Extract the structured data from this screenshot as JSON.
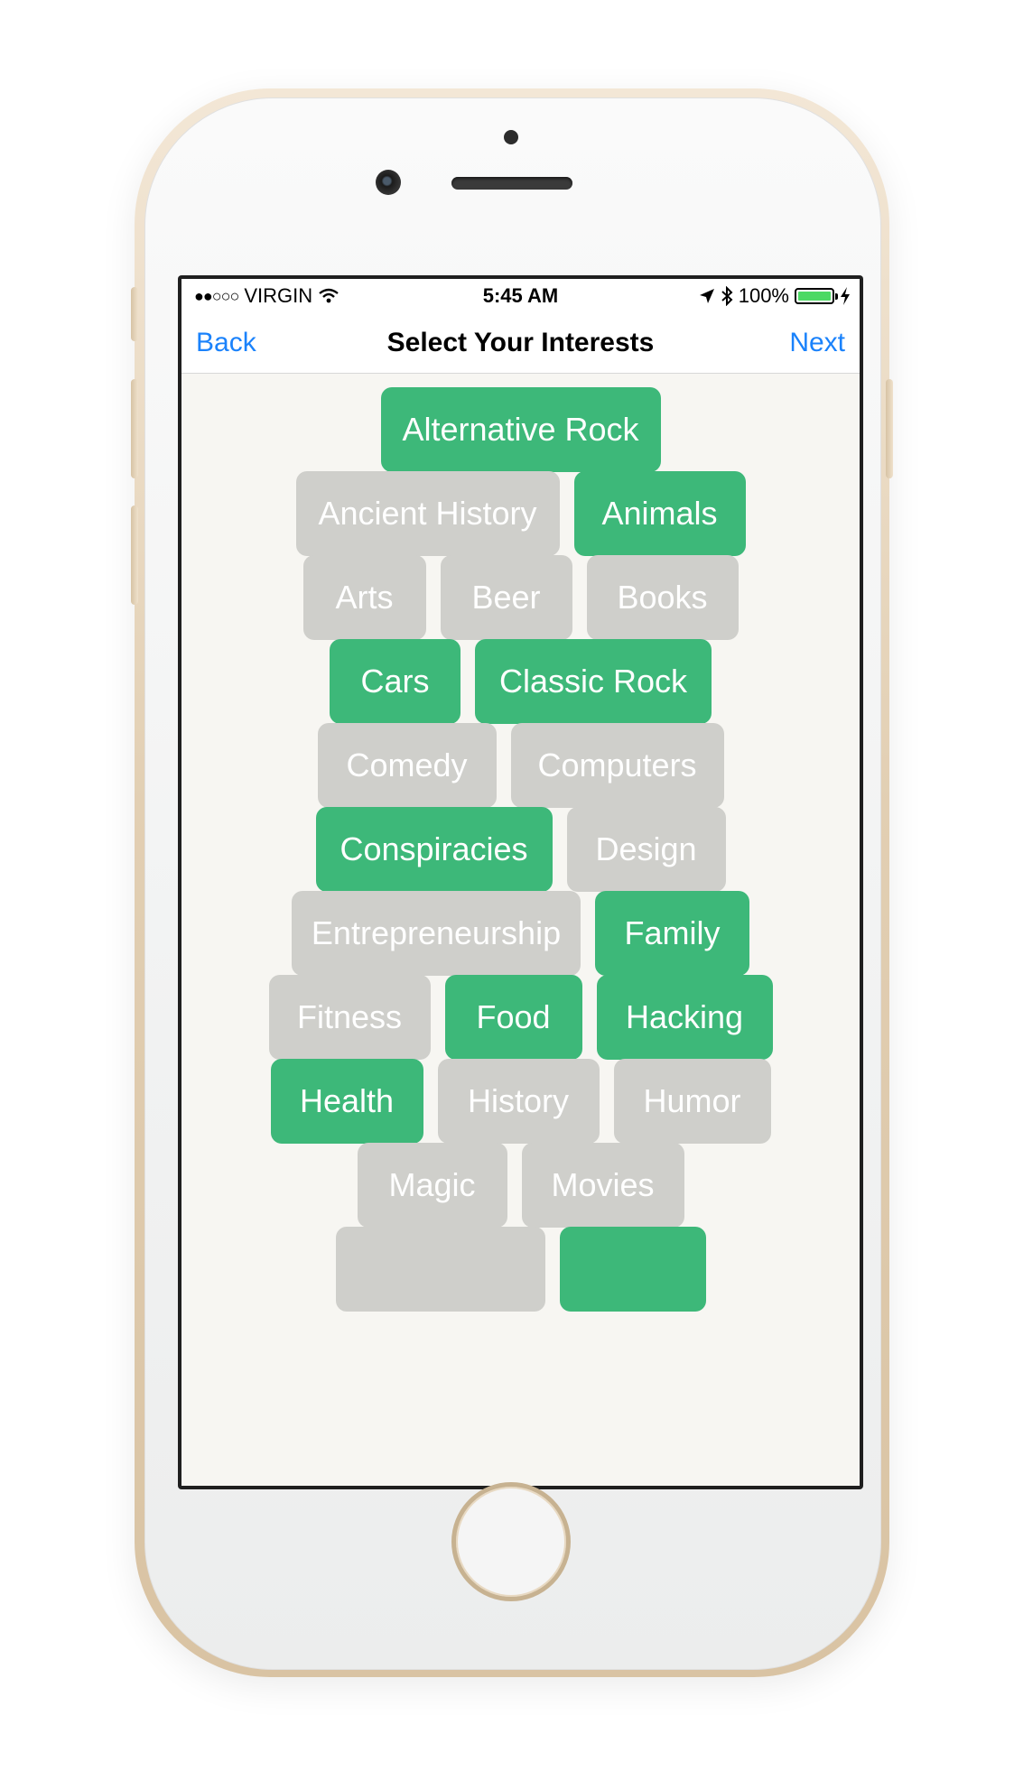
{
  "status_bar": {
    "carrier": "VIRGIN",
    "signal": "●●○○○",
    "time": "5:45 AM",
    "battery_percent": "100%"
  },
  "nav": {
    "back_label": "Back",
    "title": "Select Your Interests",
    "next_label": "Next"
  },
  "colors": {
    "selected": "#3db879",
    "unselected": "#cfcfcb",
    "link": "#1a82fb"
  },
  "interests": [
    [
      {
        "label": "Alternative Rock",
        "selected": true
      }
    ],
    [
      {
        "label": "Ancient History",
        "selected": false
      },
      {
        "label": "Animals",
        "selected": true
      }
    ],
    [
      {
        "label": "Arts",
        "selected": false
      },
      {
        "label": "Beer",
        "selected": false
      },
      {
        "label": "Books",
        "selected": false
      }
    ],
    [
      {
        "label": "Cars",
        "selected": true
      },
      {
        "label": "Classic Rock",
        "selected": true
      }
    ],
    [
      {
        "label": "Comedy",
        "selected": false
      },
      {
        "label": "Computers",
        "selected": false
      }
    ],
    [
      {
        "label": "Conspiracies",
        "selected": true
      },
      {
        "label": "Design",
        "selected": false
      }
    ],
    [
      {
        "label": "Entrepreneurship",
        "selected": false
      },
      {
        "label": "Family",
        "selected": true
      }
    ],
    [
      {
        "label": "Fitness",
        "selected": false
      },
      {
        "label": "Food",
        "selected": true
      },
      {
        "label": "Hacking",
        "selected": true
      }
    ],
    [
      {
        "label": "Health",
        "selected": true
      },
      {
        "label": "History",
        "selected": false
      },
      {
        "label": "Humor",
        "selected": false
      }
    ],
    [
      {
        "label": "Magic",
        "selected": false
      },
      {
        "label": "Movies",
        "selected": false
      }
    ],
    [
      {
        "label": "",
        "selected": false
      },
      {
        "label": "",
        "selected": true
      }
    ]
  ]
}
